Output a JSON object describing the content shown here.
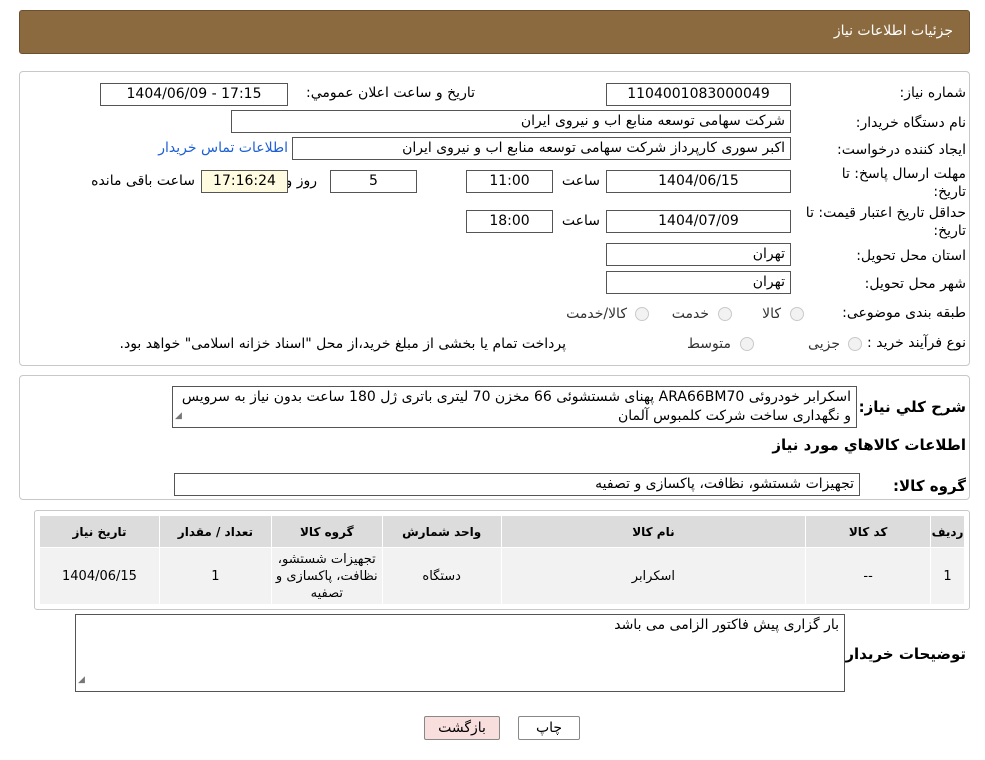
{
  "header": {
    "title": "جزئیات اطلاعات نیاز"
  },
  "form": {
    "need_number_label": "شماره نیاز:",
    "need_number": "1104001083000049",
    "announce_label": "تاریخ و ساعت اعلان عمومي:",
    "announce_value": "1404/06/09 - 17:15",
    "buyer_label": "نام دستگاه خريدار:",
    "buyer_value": "شرکت سهامی توسعه منابع اب و نیروی ایران",
    "creator_label": "ایجاد کننده درخواست:",
    "creator_value": "اکبر سوری کارپرداز شرکت سهامی توسعه منابع اب و نیروی ایران",
    "contact_link": "اطلاعات تماس خریدار",
    "deadline_label_1": "مهلت ارسال پاسخ: تا",
    "deadline_label_2": "تاریخ:",
    "deadline_date": "1404/06/15",
    "hour_label": "ساعت",
    "deadline_time": "11:00",
    "days_value": "5",
    "days_label": "روز و",
    "remaining_time": "17:16:24",
    "remaining_label": "ساعت باقی مانده",
    "validity_label_1": "حداقل تاریخ اعتبار قیمت: تا",
    "validity_label_2": "تاریخ:",
    "validity_date": "1404/07/09",
    "validity_hour_label": "ساعت",
    "validity_time": "18:00",
    "province_label": "استان محل تحویل:",
    "province_value": "تهران",
    "city_label": "شهر محل تحویل:",
    "city_value": "تهران",
    "category_label": "طبقه بندی موضوعی:",
    "category_options": [
      "کالا",
      "خدمت",
      "کالا/خدمت"
    ],
    "purchase_label": "نوع فرآیند خرید :",
    "purchase_options": [
      "جزیی",
      "متوسط"
    ],
    "purchase_note": "پرداخت تمام یا بخشی از مبلغ خرید،از محل \"اسناد خزانه اسلامی\" خواهد بود."
  },
  "description": {
    "label": "شرح كلي نياز:",
    "text": "اسکرابر خودروئی ARA66BM70 پهنای شستشوئی 66 مخزن 70 لیتری باتری ژل 180 ساعت  بدون نیاز به سرویس و نگهداری ساخت شرکت کلمبوس آلمان"
  },
  "goods": {
    "section_title": "اطلاعات كالاهاي مورد نياز",
    "group_label": "گروه كالا:",
    "group_value": "تجهیزات شستشو، نظافت، پاکسازی و تصفیه"
  },
  "table": {
    "headers": [
      "ردیف",
      "کد کالا",
      "نام کالا",
      "واحد شمارش",
      "گروه کالا",
      "تعداد / مقدار",
      "تاریخ نیاز"
    ],
    "rows": [
      [
        "1",
        "--",
        "اسکرابر",
        "دستگاه",
        "تجهیزات شستشو، نظافت، پاکسازی و تصفیه",
        "1",
        "1404/06/15"
      ]
    ]
  },
  "buyer_notes": {
    "label": "توضیحات خریدار:",
    "text": "بار گزاری پیش فاکتور الزامی می باشد"
  },
  "buttons": {
    "print": "چاپ",
    "back": "بازگشت"
  },
  "colors": {
    "header": "#8b6a40",
    "back_button": "#f9dede",
    "remaining_bg": "#fffbe0"
  }
}
